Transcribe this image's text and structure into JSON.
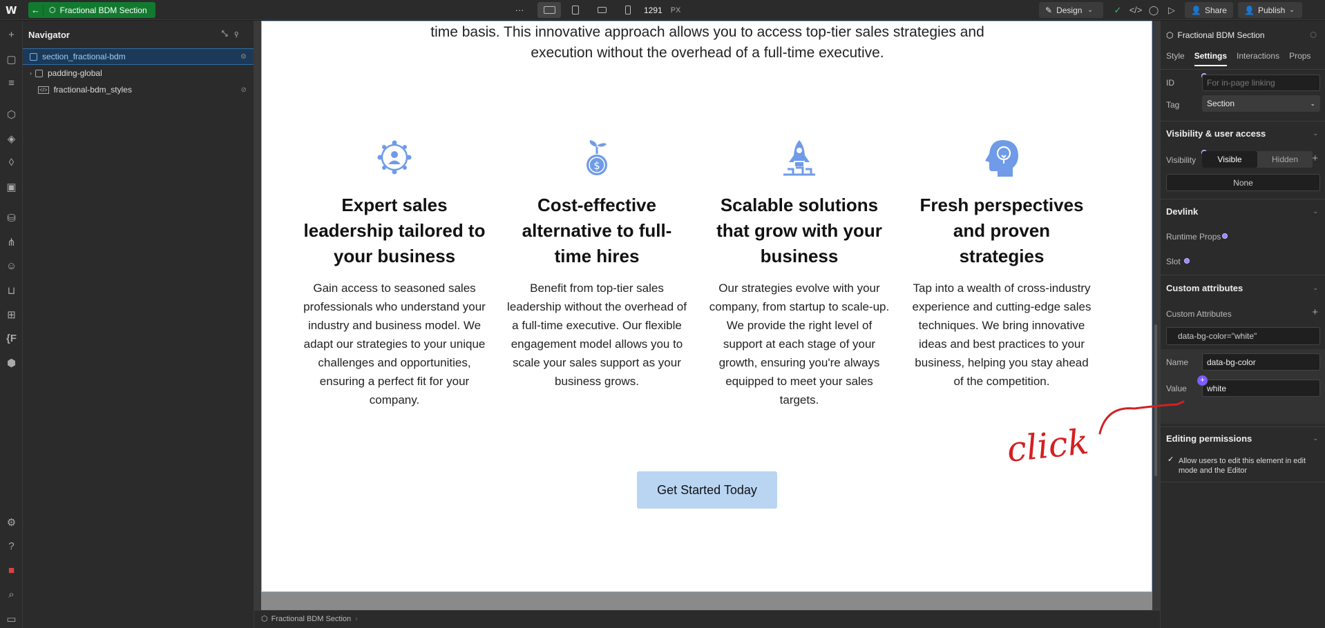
{
  "topbar": {
    "logo": "W",
    "back_arrow": "←",
    "component_name": "Fractional BDM Section",
    "more": "···",
    "width_value": "1291",
    "width_unit": "PX",
    "mode_label": "Design",
    "share_label": "Share",
    "publish_label": "Publish"
  },
  "navigator": {
    "title": "Navigator",
    "items": [
      {
        "label": "section_fractional-bdm"
      },
      {
        "label": "padding-global"
      },
      {
        "label": "fractional-bdm_styles"
      }
    ]
  },
  "canvas": {
    "intro_line1": "time basis. This innovative approach allows you to access top-tier sales strategies and",
    "intro_line2": "execution without the overhead of a full-time executive.",
    "features": [
      {
        "icon": "network-person-icon",
        "title": "Expert sales leadership tailored to your business",
        "body": "Gain access to seasoned sales professionals who understand your industry and business model. We adapt our strategies to your unique challenges and opportunities, ensuring a perfect fit for your company."
      },
      {
        "icon": "money-plant-icon",
        "title": "Cost-effective alternative to full-time hires",
        "body": "Benefit from top-tier sales leadership without the overhead of a full-time executive. Our flexible engagement model allows you to scale your sales support as your business grows."
      },
      {
        "icon": "rocket-launch-icon",
        "title": "Scalable solutions that grow with your business",
        "body": "Our strategies evolve with your company, from startup to scale-up. We provide the right level of support at each stage of your growth, ensuring you're always equipped to meet your sales targets."
      },
      {
        "icon": "head-idea-icon",
        "title": "Fresh perspectives and proven strategies",
        "body": "Tap into a wealth of cross-industry experience and cutting-edge sales techniques. We bring innovative ideas and best practices to your business, helping you stay ahead of the competition."
      }
    ],
    "cta_label": "Get Started Today",
    "accent_color": "#6f9be8"
  },
  "statusbar": {
    "breadcrumb": "Fractional BDM Section"
  },
  "panel": {
    "element_name": "Fractional BDM Section",
    "tabs": [
      "Style",
      "Settings",
      "Interactions",
      "Props"
    ],
    "id_label": "ID",
    "id_placeholder": "For in-page linking",
    "tag_label": "Tag",
    "tag_value": "Section",
    "visibility_heading": "Visibility & user access",
    "visibility_label": "Visibility",
    "visible_option": "Visible",
    "hidden_option": "Hidden",
    "none_label": "None",
    "devlink_heading": "Devlink",
    "runtime_props_label": "Runtime Props",
    "slot_label": "Slot",
    "custom_attrs_heading": "Custom attributes",
    "custom_attrs_label": "Custom Attributes",
    "attr_preview": "data-bg-color=\"white\"",
    "name_label": "Name",
    "name_value": "data-bg-color",
    "value_label": "Value",
    "value_value": "white",
    "editing_heading": "Editing permissions",
    "editing_checkbox_label": "Allow users to edit this element in edit mode and the Editor"
  },
  "annotation": {
    "text": "click",
    "color": "#d42020"
  }
}
